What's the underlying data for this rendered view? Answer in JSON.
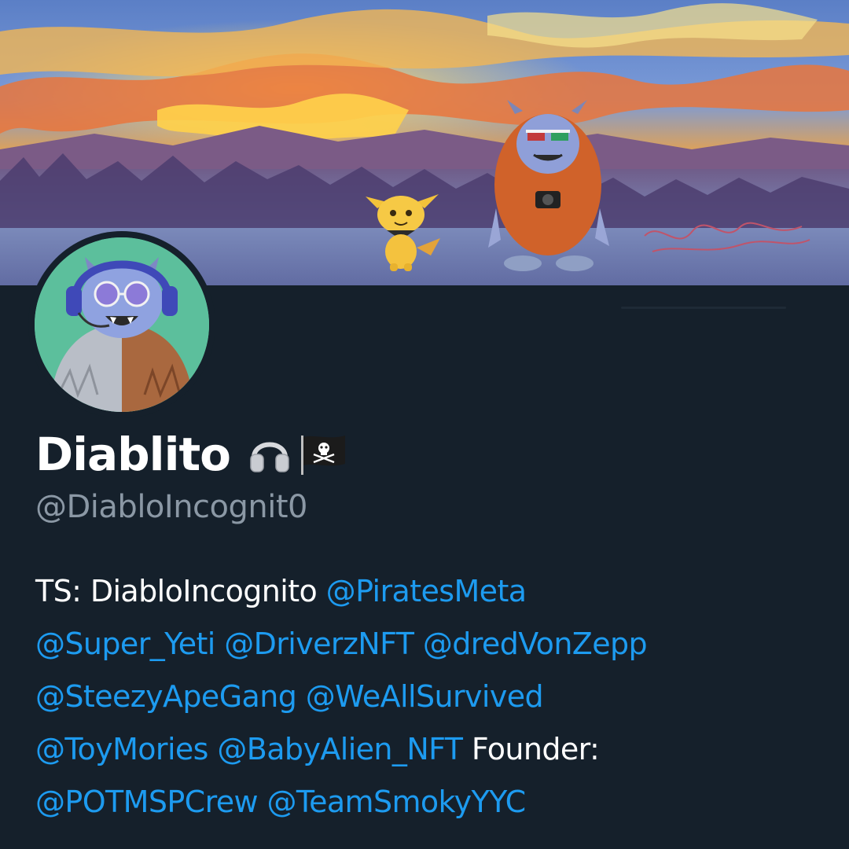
{
  "profile": {
    "display_name": "Diablito",
    "name_emojis": [
      "headphones-icon",
      "pirate-flag-icon"
    ],
    "handle": "@DiabloIncognit0"
  },
  "bio": {
    "lines": [
      [
        {
          "text": "TS: DiabloIncognito ",
          "type": "plain"
        },
        {
          "text": "@PiratesMeta",
          "type": "mention"
        }
      ],
      [
        {
          "text": "@Super_Yeti",
          "type": "mention"
        },
        {
          "text": " ",
          "type": "plain"
        },
        {
          "text": "@DriverzNFT",
          "type": "mention"
        },
        {
          "text": " ",
          "type": "plain"
        },
        {
          "text": "@dredVonZepp",
          "type": "mention"
        }
      ],
      [
        {
          "text": "@SteezyApeGang",
          "type": "mention"
        },
        {
          "text": " ",
          "type": "plain"
        },
        {
          "text": "@WeAllSurvived",
          "type": "mention"
        }
      ],
      [
        {
          "text": "@ToyMories",
          "type": "mention"
        },
        {
          "text": " ",
          "type": "plain"
        },
        {
          "text": "@BabyAlien_NFT",
          "type": "mention"
        },
        {
          "text": " Founder:",
          "type": "plain"
        }
      ],
      [
        {
          "text": "@POTMSPCrew",
          "type": "mention"
        },
        {
          "text": " ",
          "type": "plain"
        },
        {
          "text": "@TeamSmokyYYC",
          "type": "mention"
        }
      ]
    ]
  },
  "colors": {
    "background": "#15202b",
    "mention": "#1d9bf0",
    "secondary_text": "#8b98a5",
    "avatar_background": "#5cbf9c"
  }
}
